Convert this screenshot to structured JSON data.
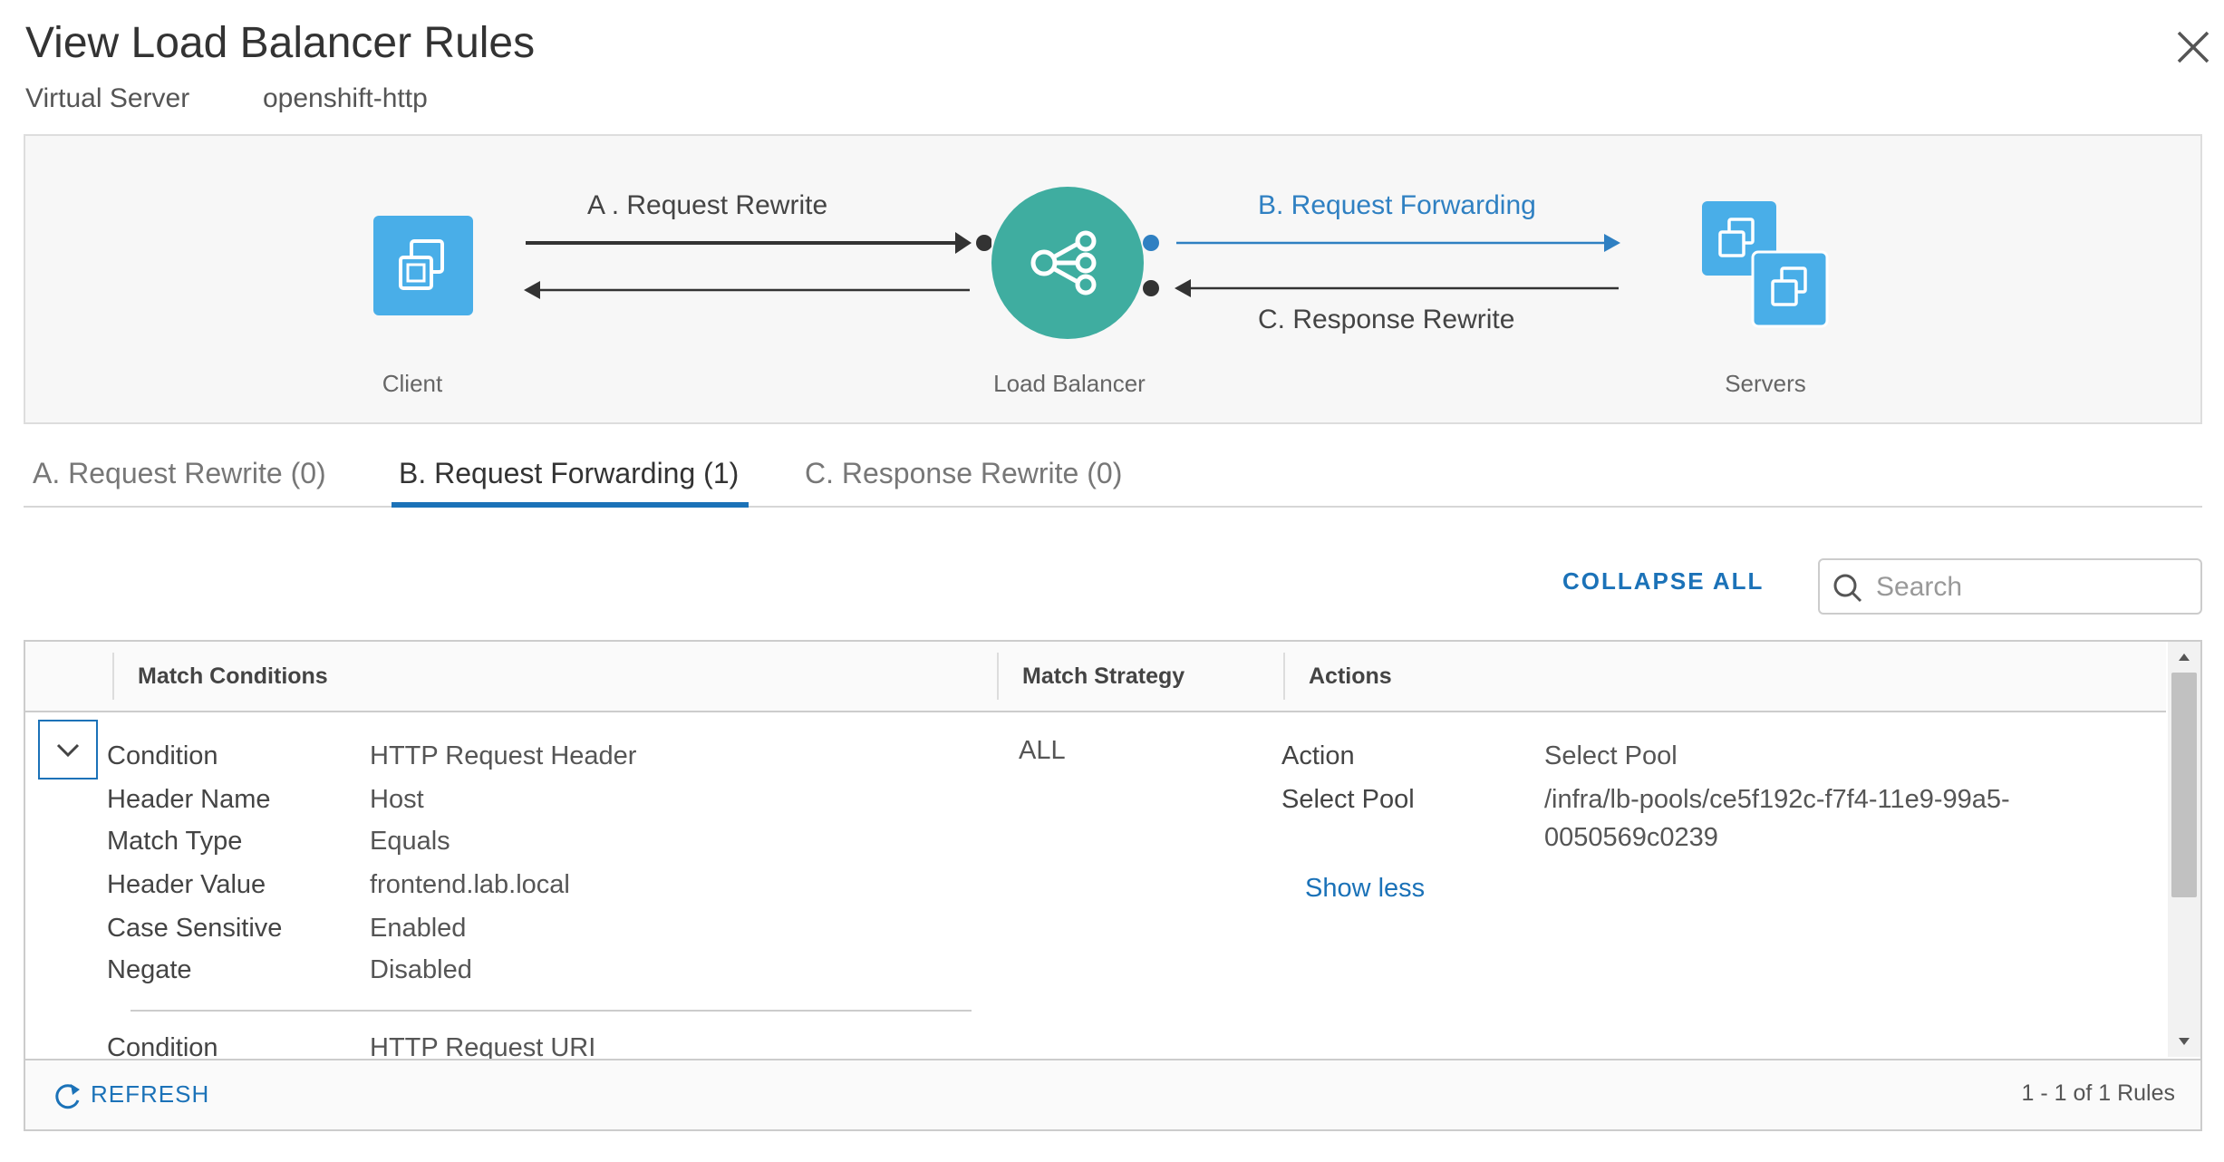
{
  "dialog": {
    "title": "View Load Balancer Rules",
    "subtitle_label": "Virtual Server",
    "subtitle_value": "openshift-http"
  },
  "diagram": {
    "client_label": "Client",
    "load_balancer_label": "Load Balancer",
    "servers_label": "Servers",
    "request_rewrite_label": "A . Request Rewrite",
    "request_forwarding_label": "B. Request Forwarding",
    "response_rewrite_label": "C. Response Rewrite"
  },
  "tabs": [
    {
      "label": "A. Request Rewrite (0)",
      "active": false
    },
    {
      "label": "B. Request Forwarding (1)",
      "active": true
    },
    {
      "label": "C. Response Rewrite (0)",
      "active": false
    }
  ],
  "toolbar": {
    "collapse_all_label": "COLLAPSE ALL",
    "search_placeholder": "Search",
    "search_value": ""
  },
  "grid": {
    "columns": [
      "Match Conditions",
      "Match Strategy",
      "Actions"
    ],
    "rows": [
      {
        "conditions": [
          {
            "label": "Condition",
            "value": "HTTP Request Header"
          },
          {
            "label": "Header Name",
            "value": "Host"
          },
          {
            "label": "Match Type",
            "value": "Equals"
          },
          {
            "label": "Header Value",
            "value": "frontend.lab.local"
          },
          {
            "label": "Case Sensitive",
            "value": "Enabled"
          },
          {
            "label": "Negate",
            "value": "Disabled"
          }
        ],
        "next_condition": {
          "label": "Condition",
          "value": "HTTP Request URI"
        },
        "match_strategy": "ALL",
        "actions": [
          {
            "label": "Action",
            "value": "Select Pool"
          },
          {
            "label": "Select Pool",
            "value_line1": "/infra/lb-pools/ce5f192c-f7f4-11e9-99a5-",
            "value_line2": "0050569c0239"
          }
        ],
        "show_less_label": "Show less"
      }
    ],
    "footer": {
      "refresh_label": "REFRESH",
      "count_label": "1 - 1 of 1 Rules"
    }
  },
  "colors": {
    "accent_blue": "#1b72b8",
    "icon_blue": "#49aee8",
    "load_balancer_teal": "#3fada0",
    "forwarding_blue": "#2f80c2"
  }
}
